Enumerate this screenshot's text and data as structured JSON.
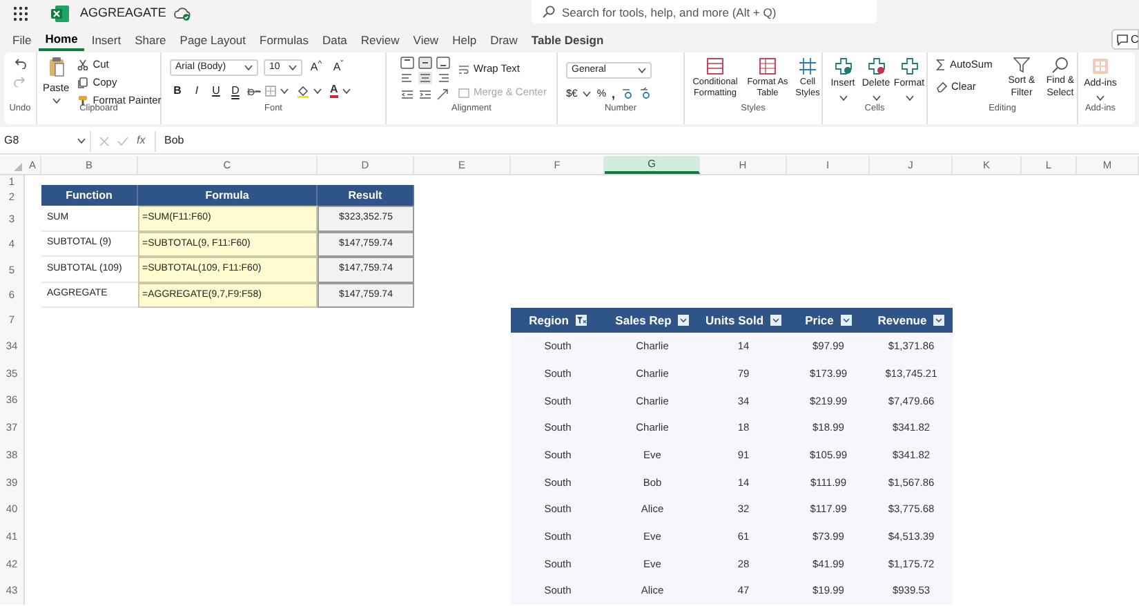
{
  "app": {
    "title": "AGGREAGATE",
    "search": {
      "placeholder": "Search for tools, help, and more (Alt + Q)"
    }
  },
  "menu_tabs": [
    {
      "label": "File",
      "selected": false,
      "kind": "tab"
    },
    {
      "label": "Home",
      "selected": true,
      "kind": "tab"
    },
    {
      "label": "Insert",
      "selected": false,
      "kind": "tab"
    },
    {
      "label": "Share",
      "selected": false,
      "kind": "tab"
    },
    {
      "label": "Page Layout",
      "selected": false,
      "kind": "tab"
    },
    {
      "label": "Formulas",
      "selected": false,
      "kind": "tab"
    },
    {
      "label": "Data",
      "selected": false,
      "kind": "tab"
    },
    {
      "label": "Review",
      "selected": false,
      "kind": "tab"
    },
    {
      "label": "View",
      "selected": false,
      "kind": "tab"
    },
    {
      "label": "Help",
      "selected": false,
      "kind": "tab"
    },
    {
      "label": "Draw",
      "selected": false,
      "kind": "tab"
    },
    {
      "label": "Table Design",
      "selected": false,
      "kind": "contextual"
    }
  ],
  "comments_button": "C",
  "ribbon": {
    "undo": {
      "label": "Undo"
    },
    "clipboard": {
      "paste": "Paste",
      "cut": "Cut",
      "copy": "Copy",
      "format_painter": "Format Painter",
      "label": "Clipboard"
    },
    "font": {
      "font_name": "Arial (Body)",
      "font_size": "10",
      "grow": "A$^{^}$",
      "shrink": "A$^{ˇ}$",
      "style_buttons": [
        "B",
        "I",
        "U",
        "D"
      ],
      "font_color": "A",
      "label": "Font"
    },
    "alignment": {
      "wrap_text": "Wrap Text",
      "merge_center": {
        "label": "Merge & Center",
        "disabled": true
      },
      "label": "Alignment"
    },
    "number": {
      "format": "General",
      "currency": "$€",
      "percent": "%",
      "comma": ",",
      "label": "Number"
    },
    "styles": {
      "buttons": [
        "Conditional Formatting",
        "Format As Table",
        "Cell Styles"
      ],
      "label": "Styles"
    },
    "cells": {
      "buttons": [
        "Insert",
        "Delete",
        "Format"
      ],
      "label": "Cells"
    },
    "editing": {
      "autosum": "AutoSum",
      "clear": "Clear",
      "sort_filter": "Sort & Filter",
      "find_select": "Find & Select",
      "label": "Editing"
    },
    "add_ins": {
      "button": "Add-ins",
      "label": "Add-ins"
    }
  },
  "formula_bar": {
    "name_box": "G8",
    "fx": "fx",
    "value": "Bob"
  },
  "columns": [
    {
      "label": "A",
      "selected": false
    },
    {
      "label": "B",
      "selected": false
    },
    {
      "label": "C",
      "selected": false
    },
    {
      "label": "D",
      "selected": false
    },
    {
      "label": "E",
      "selected": false
    },
    {
      "label": "F",
      "selected": false
    },
    {
      "label": "G",
      "selected": true
    },
    {
      "label": "H",
      "selected": false
    },
    {
      "label": "I",
      "selected": false
    },
    {
      "label": "J",
      "selected": false
    },
    {
      "label": "K",
      "selected": false
    },
    {
      "label": "L",
      "selected": false
    },
    {
      "label": "M",
      "selected": false
    }
  ],
  "row_numbers": [
    "1",
    "2",
    "3",
    "4",
    "5",
    "6",
    "7",
    "34",
    "35",
    "36",
    "37",
    "38",
    "39",
    "40",
    "41",
    "42",
    "43"
  ],
  "summary_table": {
    "columns": [
      "Function",
      "Formula",
      "Result"
    ],
    "rows": [
      [
        "SUM",
        "=SUM(F11:F60)",
        "$323,352.75"
      ],
      [
        "SUBTOTAL (9)",
        "=SUBTOTAL(9, F11:F60)",
        "$147,759.74"
      ],
      [
        "SUBTOTAL (109)",
        "=SUBTOTAL(109, F11:F60)",
        "$147,759.74"
      ],
      [
        "AGGREGATE",
        "=AGGREGATE(9,7,F9:F58)",
        "$147,759.74"
      ]
    ]
  },
  "data_table": {
    "columns": [
      {
        "label": "Region",
        "filtered": true
      },
      {
        "label": "Sales Rep",
        "filtered": false
      },
      {
        "label": "Units Sold",
        "filtered": false
      },
      {
        "label": "Price",
        "filtered": false
      },
      {
        "label": "Revenue",
        "filtered": false
      }
    ],
    "rows": [
      [
        "South",
        "Charlie",
        "14",
        "$97.99",
        "$1,371.86"
      ],
      [
        "South",
        "Charlie",
        "79",
        "$173.99",
        "$13,745.21"
      ],
      [
        "South",
        "Charlie",
        "34",
        "$219.99",
        "$7,479.66"
      ],
      [
        "South",
        "Charlie",
        "18",
        "$18.99",
        "$341.82"
      ],
      [
        "South",
        "Eve",
        "91",
        "$105.99",
        "$341.82"
      ],
      [
        "South",
        "Bob",
        "14",
        "$111.99",
        "$1,567.86"
      ],
      [
        "South",
        "Alice",
        "32",
        "$117.99",
        "$3,775.68"
      ],
      [
        "South",
        "Eve",
        "61",
        "$73.99",
        "$4,513.39"
      ],
      [
        "South",
        "Eve",
        "28",
        "$41.99",
        "$1,175.72"
      ],
      [
        "South",
        "Alice",
        "47",
        "$19.99",
        "$939.53"
      ]
    ]
  }
}
